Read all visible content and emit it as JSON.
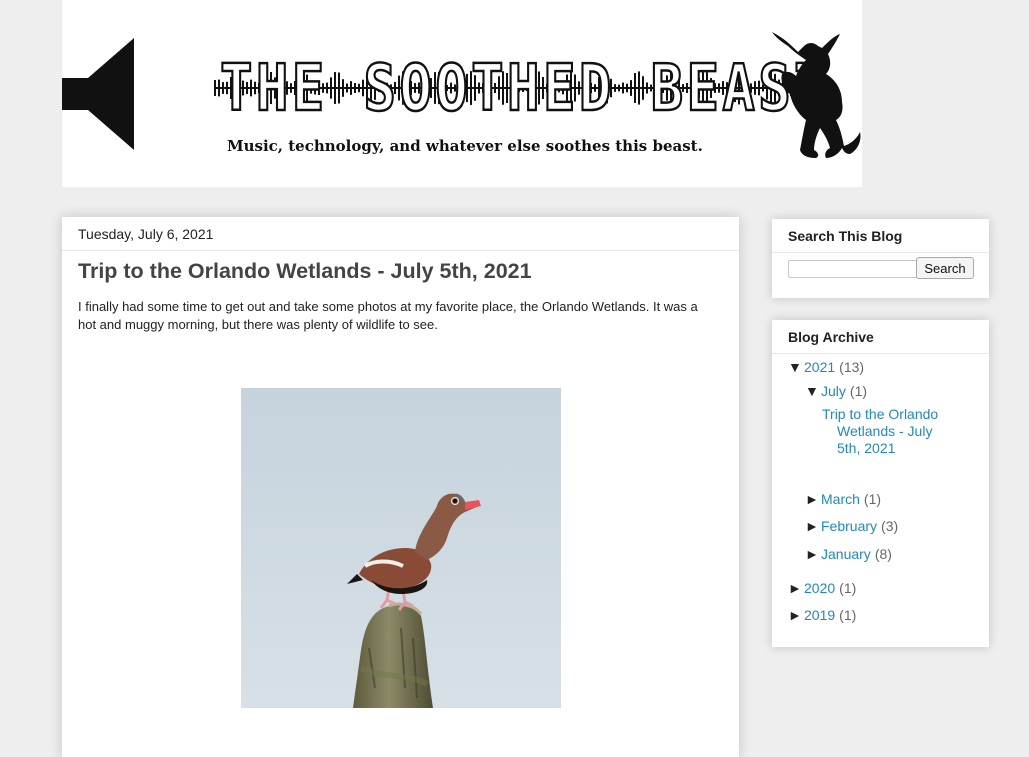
{
  "header": {
    "title": "THE SOOTHED BEAST",
    "tagline": "Music, technology, and whatever else soothes this beast.",
    "icons": [
      "speaker-icon",
      "beast-logo"
    ]
  },
  "post": {
    "date": "Tuesday, July 6, 2021",
    "title": "Trip to the Orlando Wetlands - July 5th, 2021",
    "body": "I finally had some time to get out and take some photos at my favorite place, the Orlando Wetlands.  It was a hot and muggy morning, but there was plenty of wildlife to see.",
    "image": "duck-on-stump-photo"
  },
  "sidebar": {
    "search": {
      "heading": "Search This Blog",
      "value": "",
      "button_label": "Search"
    },
    "archive": {
      "heading": "Blog Archive",
      "expanded_toggle": "▼",
      "collapsed_toggle": "►",
      "years": [
        {
          "year": "2021",
          "count": "(13)",
          "expanded": true,
          "months": [
            {
              "month": "July",
              "count": "(1)",
              "expanded": true,
              "posts": [
                "Trip to the Orlando Wetlands - July 5th, 2021"
              ]
            },
            {
              "month": "March",
              "count": "(1)",
              "expanded": false
            },
            {
              "month": "February",
              "count": "(3)",
              "expanded": false
            },
            {
              "month": "January",
              "count": "(8)",
              "expanded": false
            }
          ]
        },
        {
          "year": "2020",
          "count": "(1)",
          "expanded": false
        },
        {
          "year": "2019",
          "count": "(1)",
          "expanded": false
        }
      ]
    }
  },
  "colors": {
    "page_background": "#eeeeee",
    "link": "#2288bb",
    "post_title": "#444444"
  }
}
